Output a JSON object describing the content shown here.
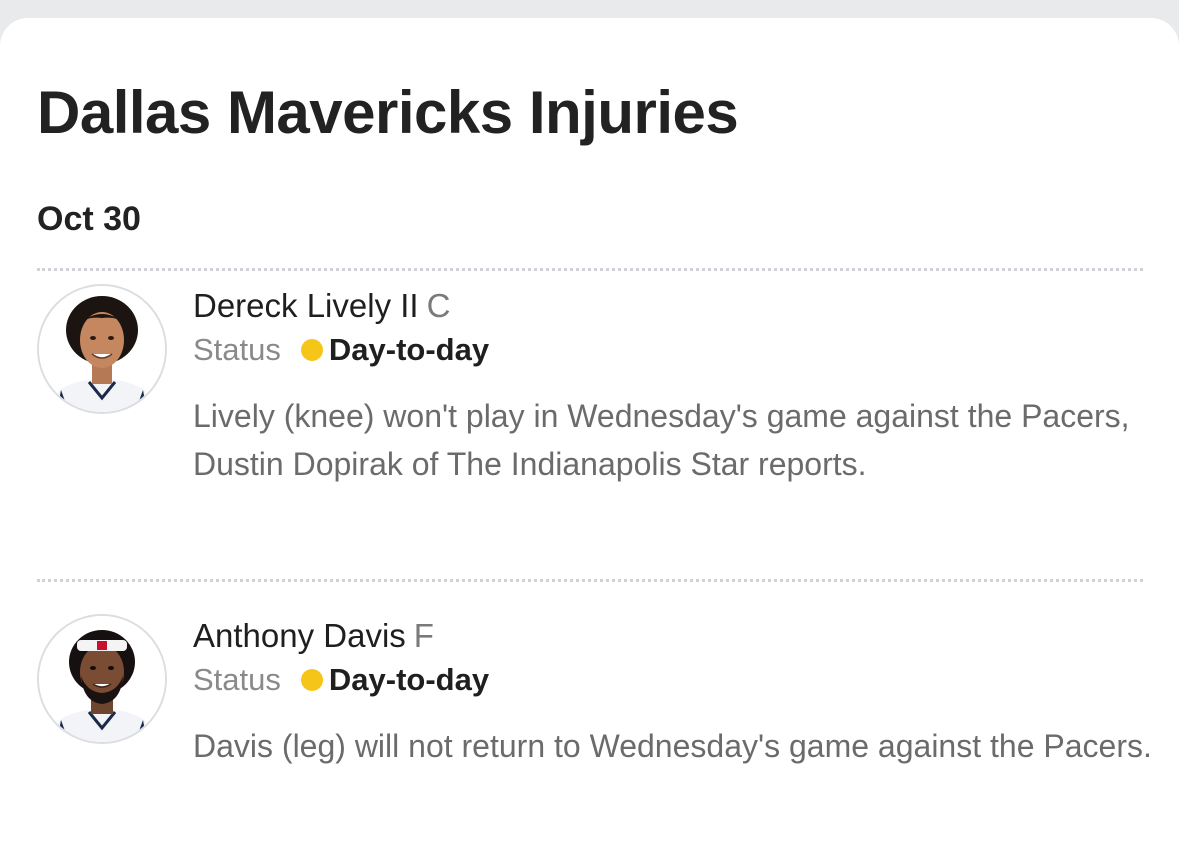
{
  "page": {
    "title": "Dallas Mavericks Injuries",
    "date": "Oct 30"
  },
  "injuries": [
    {
      "name": "Dereck Lively II",
      "position": "C",
      "status_label": "Status",
      "status": "Day-to-day",
      "status_color": "#f5c518",
      "description": "Lively (knee) won't play in Wednesday's game against the Pacers, Dustin Dopirak of The Indianapolis Star reports."
    },
    {
      "name": "Anthony Davis",
      "position": "F",
      "status_label": "Status",
      "status": "Day-to-day",
      "status_color": "#f5c518",
      "description": "Davis (leg) will not return to Wednesday's game against the Pacers."
    }
  ]
}
